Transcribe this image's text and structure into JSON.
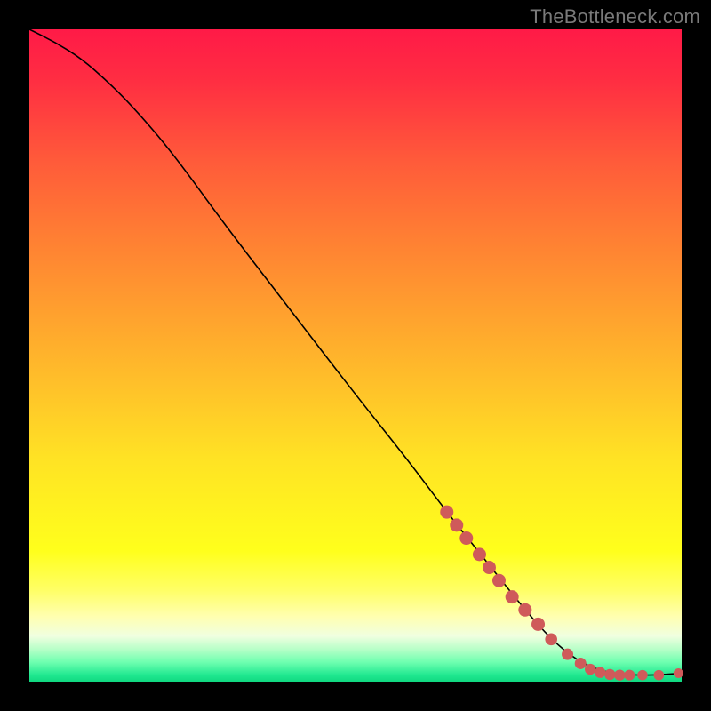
{
  "watermark": "TheBottleneck.com",
  "chart_data": {
    "type": "line",
    "title": "",
    "xlabel": "",
    "ylabel": "",
    "xlim": [
      0,
      100
    ],
    "ylim": [
      0,
      100
    ],
    "grid": false,
    "legend": false,
    "series": [
      {
        "name": "curve",
        "x": [
          0,
          4,
          8,
          12,
          16,
          22,
          30,
          40,
          50,
          58,
          64,
          70,
          76,
          80,
          84,
          88,
          92,
          96,
          100
        ],
        "y": [
          100,
          98,
          95.5,
          92,
          88,
          81,
          70,
          57,
          44,
          34,
          26,
          18.5,
          11,
          6.5,
          3.2,
          1.5,
          1.0,
          1.0,
          1.3
        ]
      }
    ],
    "markers": {
      "name": "points",
      "x": [
        64,
        65.5,
        67,
        69,
        70.5,
        72,
        74,
        76,
        78,
        80,
        82.5,
        84.5,
        86,
        87.5,
        89,
        90.5,
        92,
        94,
        96.5,
        99.5
      ],
      "y": [
        26,
        24,
        22,
        19.5,
        17.5,
        15.5,
        13,
        11,
        8.8,
        6.5,
        4.2,
        2.8,
        1.9,
        1.4,
        1.1,
        1.0,
        1.0,
        1.0,
        1.0,
        1.3
      ],
      "r": [
        7.5,
        7.5,
        7.5,
        7.5,
        7.5,
        7.5,
        7.5,
        7.5,
        7.5,
        6.8,
        6.5,
        6.5,
        6.2,
        6.2,
        6.2,
        6.2,
        6.0,
        5.8,
        5.8,
        5.5
      ]
    }
  }
}
